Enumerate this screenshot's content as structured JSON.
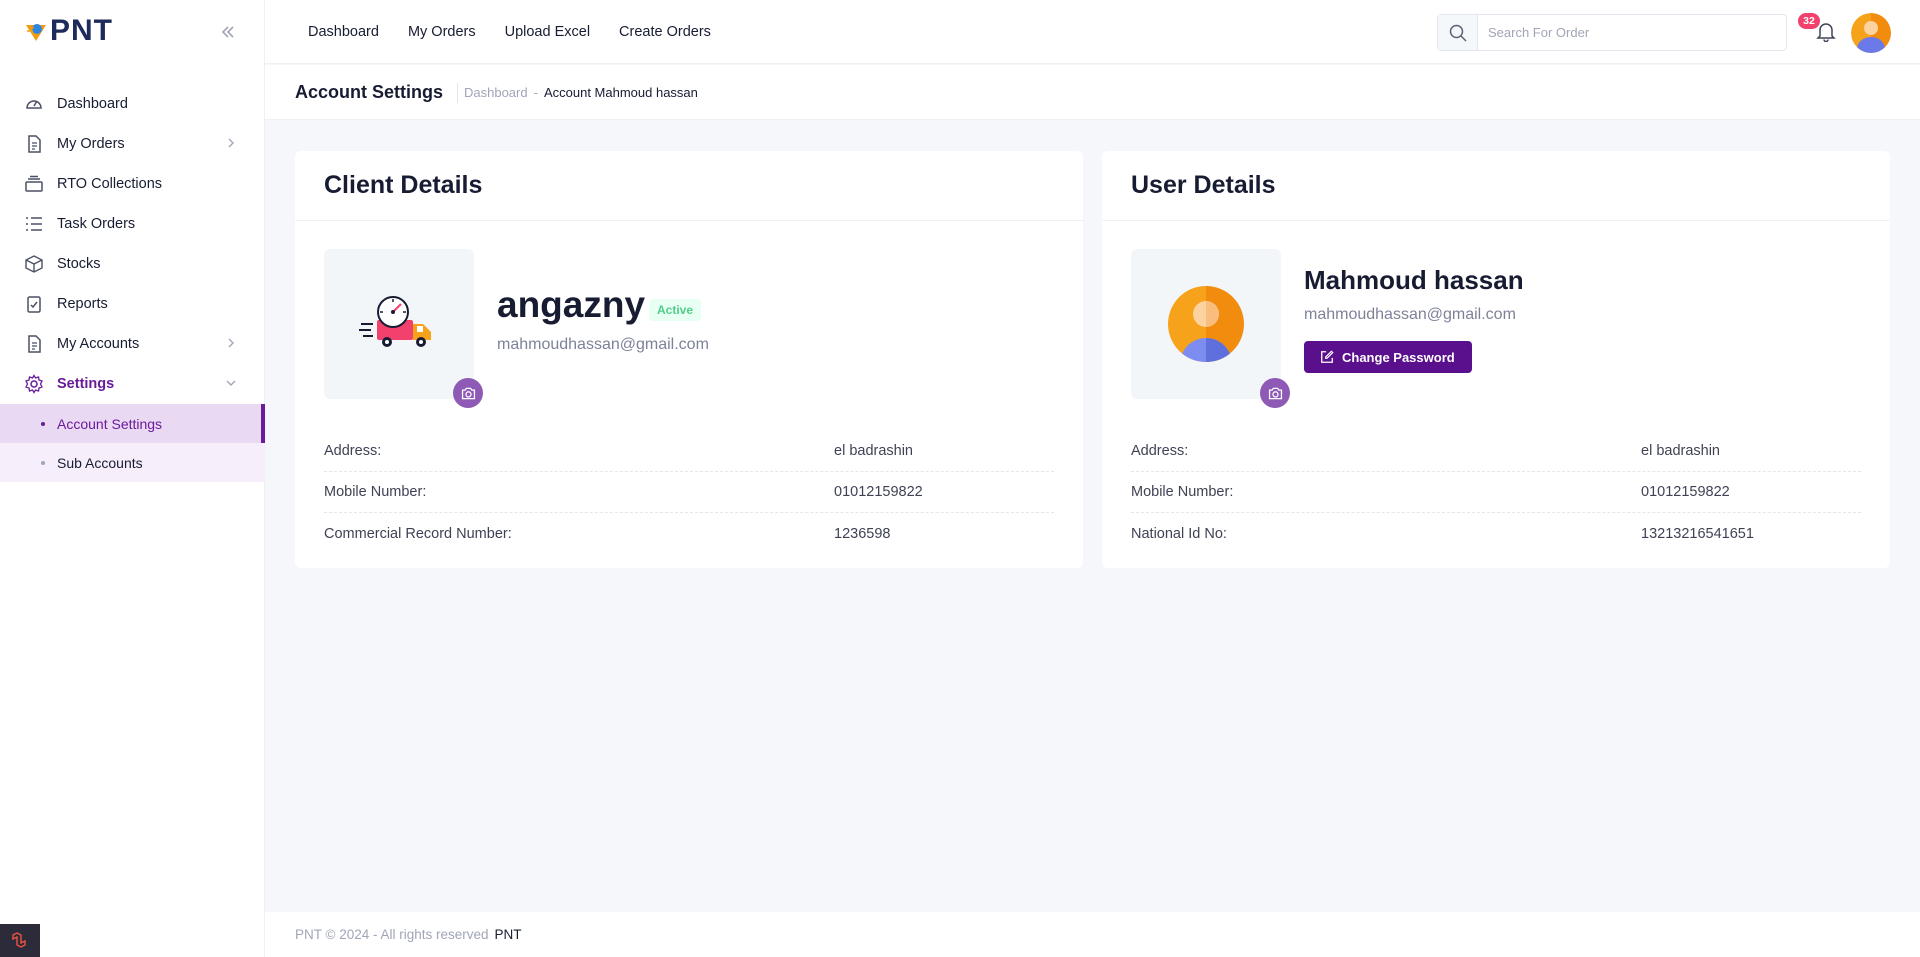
{
  "brand": {
    "name": "PNT"
  },
  "sidebar": {
    "items": [
      {
        "label": "Dashboard",
        "icon": "dashboard-gauge-icon"
      },
      {
        "label": "My Orders",
        "icon": "document-icon",
        "has_children": true
      },
      {
        "label": "RTO Collections",
        "icon": "stack-icon"
      },
      {
        "label": "Task Orders",
        "icon": "list-icon"
      },
      {
        "label": "Stocks",
        "icon": "box-icon"
      },
      {
        "label": "Reports",
        "icon": "clipboard-check-icon"
      },
      {
        "label": "My Accounts",
        "icon": "document-icon",
        "has_children": true
      },
      {
        "label": "Settings",
        "icon": "gear-icon",
        "expanded": true
      }
    ],
    "settings_children": [
      {
        "label": "Account Settings",
        "active": true
      },
      {
        "label": "Sub Accounts",
        "active": false
      }
    ]
  },
  "header": {
    "nav": [
      "Dashboard",
      "My Orders",
      "Upload Excel",
      "Create Orders"
    ],
    "search": {
      "placeholder": "Search For Order",
      "value": ""
    },
    "notifications_count": "32"
  },
  "toolbar": {
    "title": "Account Settings",
    "breadcrumb": {
      "home": "Dashboard",
      "separator": "-",
      "current": "Account Mahmoud hassan"
    }
  },
  "client_card": {
    "title": "Client Details",
    "name": "angazny",
    "status": "Active",
    "email": "mahmoudhassan@gmail.com",
    "rows": [
      {
        "label": "Address:",
        "value": "el badrashin"
      },
      {
        "label": "Mobile Number:",
        "value": "01012159822"
      },
      {
        "label": "Commercial Record Number:",
        "value": "1236598"
      }
    ]
  },
  "user_card": {
    "title": "User Details",
    "name": "Mahmoud hassan",
    "email": "mahmoudhassan@gmail.com",
    "change_password_label": "Change Password",
    "rows": [
      {
        "label": "Address:",
        "value": "el badrashin"
      },
      {
        "label": "Mobile Number:",
        "value": "01012159822"
      },
      {
        "label": "National Id No:",
        "value": "13213216541651"
      }
    ]
  },
  "footer": {
    "copyright": "PNT © 2024 - All rights reserved",
    "brand": "PNT"
  },
  "colors": {
    "accent": "#6a1b9a",
    "button": "#5a0f8c",
    "status_active": "#50cd89",
    "badge": "#f1416c"
  }
}
